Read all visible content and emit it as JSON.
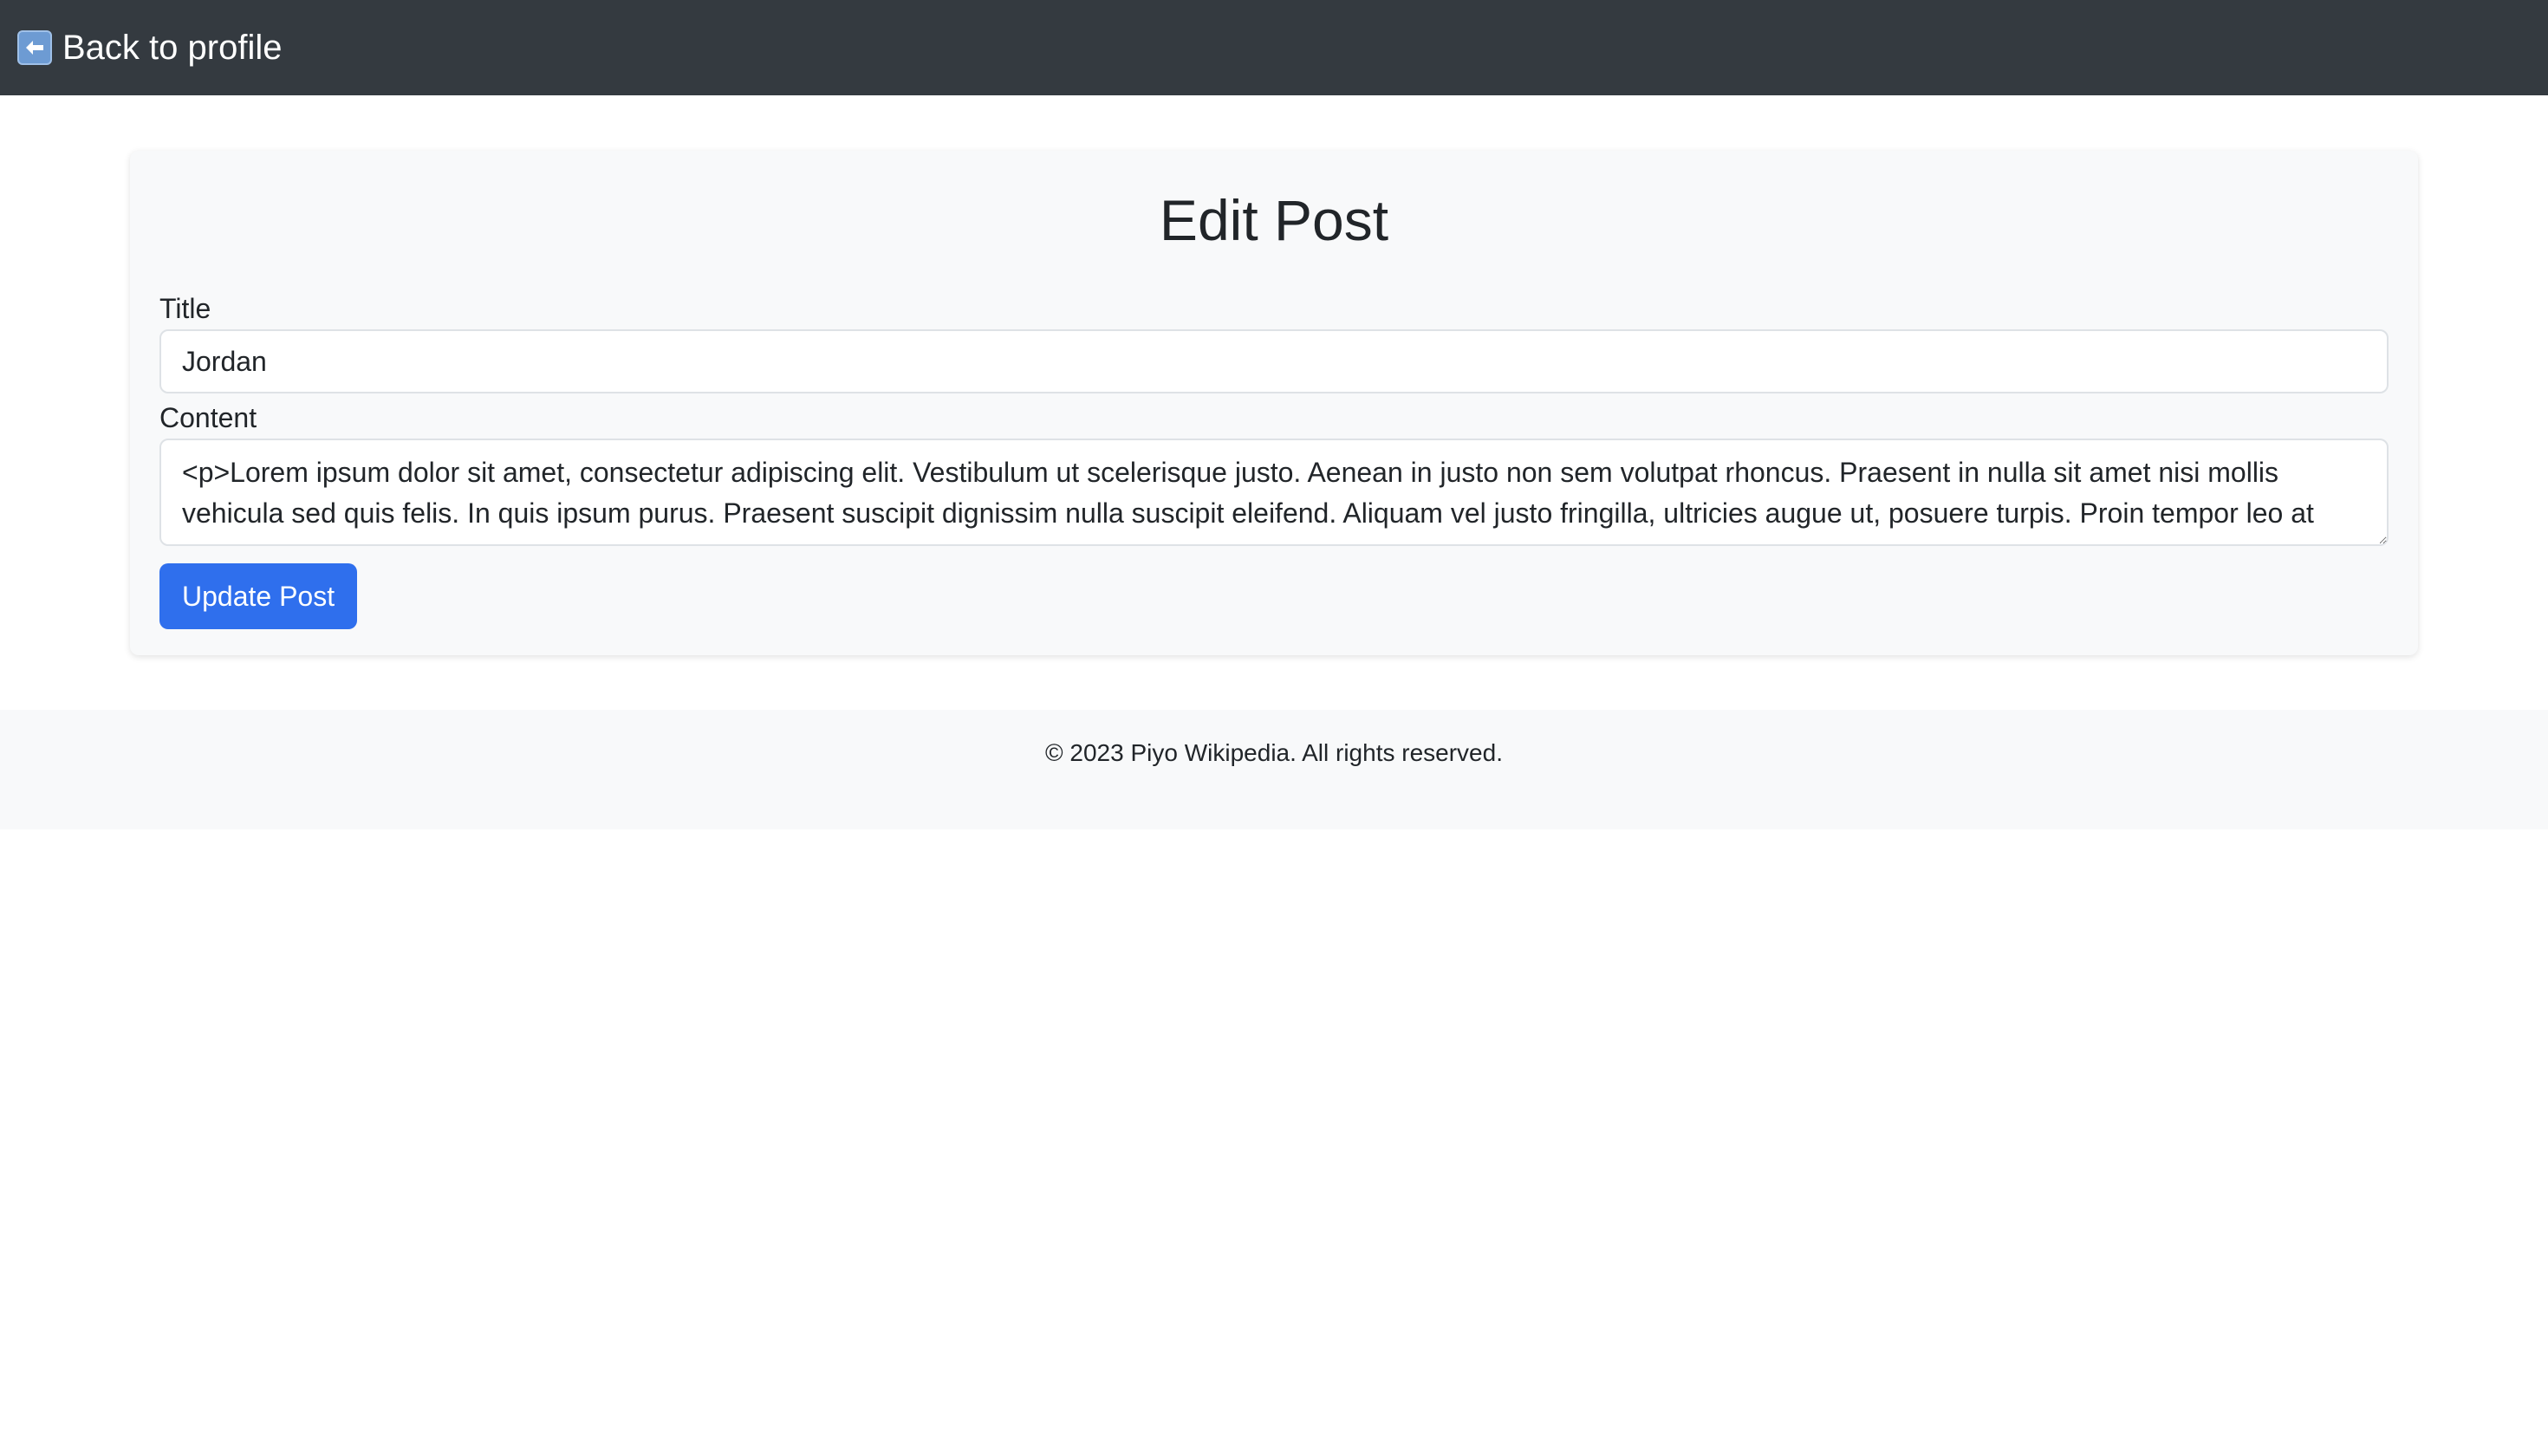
{
  "nav": {
    "back_label": "Back to profile",
    "back_icon": "left-arrow-icon"
  },
  "form": {
    "heading": "Edit Post",
    "title_label": "Title",
    "title_value": "Jordan",
    "content_label": "Content",
    "content_value": "<p>Lorem ipsum dolor sit amet, consectetur adipiscing elit. Vestibulum ut scelerisque justo. Aenean in justo non sem volutpat rhoncus. Praesent in nulla sit amet nisi mollis vehicula sed quis felis. In quis ipsum purus. Praesent suscipit dignissim nulla suscipit eleifend. Aliquam vel justo fringilla, ultricies augue ut, posuere turpis. Proin tempor leo at",
    "submit_label": "Update Post"
  },
  "footer": {
    "text": "© 2023 Piyo Wikipedia. All rights reserved."
  },
  "colors": {
    "navbar": "#343a40",
    "primary": "#2f6fed",
    "card_bg": "#f8f9fa"
  }
}
